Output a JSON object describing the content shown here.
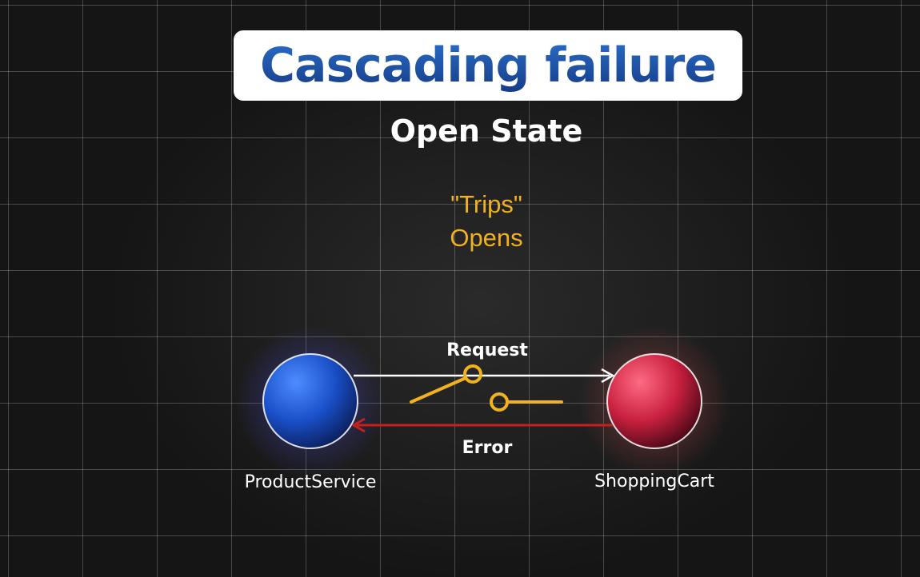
{
  "title": "Cascading failure",
  "subtitle": "Open State",
  "note": {
    "line1": "\"Trips\"",
    "line2": "Opens"
  },
  "nodes": {
    "left": {
      "label": "ProductService",
      "color": "#1a5ee0"
    },
    "right": {
      "label": "ShoppingCart",
      "color": "#d0203f"
    }
  },
  "arrows": {
    "request": {
      "label": "Request",
      "color": "#ffffff"
    },
    "error": {
      "label": "Error",
      "color": "#c81e1e"
    }
  },
  "switch": {
    "color": "#f2b21e",
    "state": "open"
  }
}
